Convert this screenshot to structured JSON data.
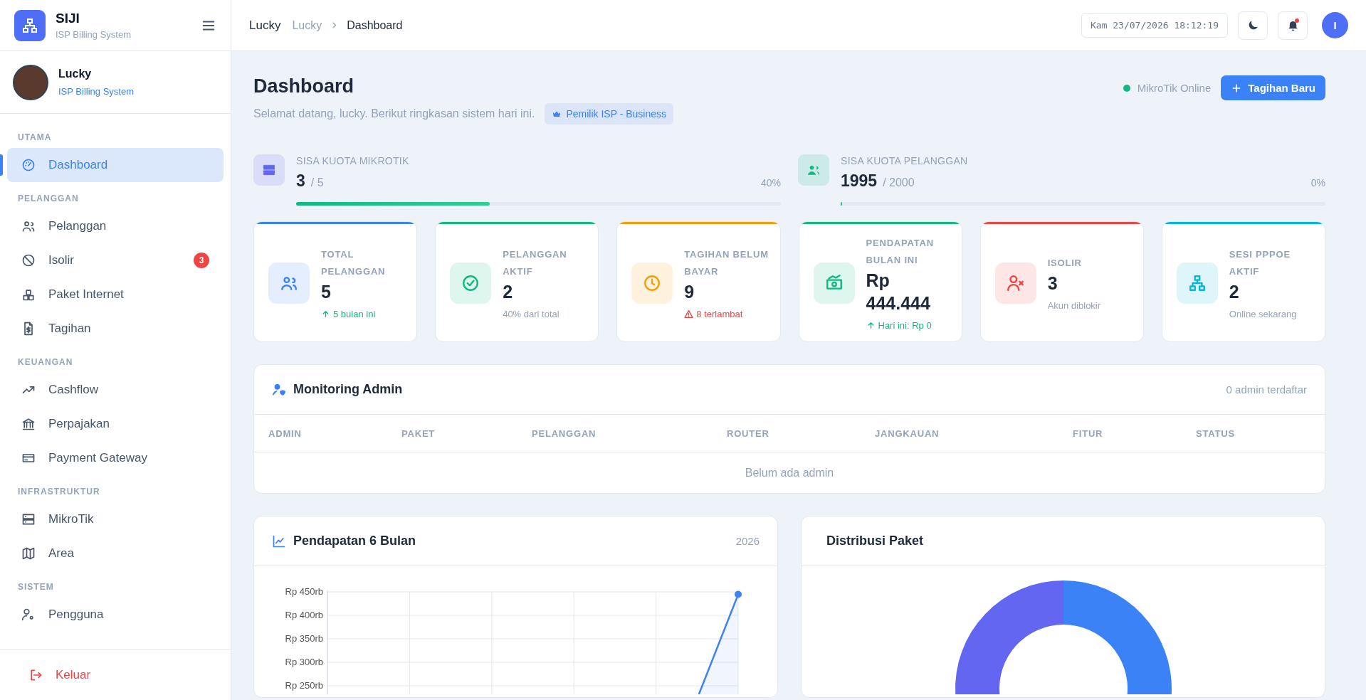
{
  "sidebar": {
    "brand": {
      "name": "SIJI",
      "subtitle": "ISP Billing System"
    },
    "user": {
      "name": "Lucky",
      "role": "ISP Billing System"
    },
    "sections": [
      {
        "title": "UTAMA",
        "items": [
          {
            "label": "Dashboard",
            "selected": true
          }
        ]
      },
      {
        "title": "PELANGGAN",
        "items": [
          {
            "label": "Pelanggan",
            "selected": false
          },
          {
            "label": "Isolir",
            "selected": false,
            "badge": "3"
          },
          {
            "label": "Paket Internet",
            "selected": false
          },
          {
            "label": "Tagihan",
            "selected": false
          }
        ]
      },
      {
        "title": "KEUANGAN",
        "items": [
          {
            "label": "Cashflow",
            "selected": false
          },
          {
            "label": "Perpajakan",
            "selected": false
          },
          {
            "label": "Payment Gateway",
            "selected": false
          }
        ]
      },
      {
        "title": "INFRASTRUKTUR",
        "items": [
          {
            "label": "MikroTik",
            "selected": false
          },
          {
            "label": "Area",
            "selected": false
          }
        ]
      },
      {
        "title": "SISTEM",
        "items": [
          {
            "label": "Pengguna",
            "selected": false
          }
        ]
      }
    ],
    "logout": "Keluar"
  },
  "header": {
    "title": "Lucky",
    "breadcrumb": [
      "Lucky",
      "Dashboard"
    ],
    "clock": "Kam 23/07/2026 18:12:19",
    "notification_unread": true,
    "avatar": "I"
  },
  "page": {
    "title": "Dashboard",
    "subtitle": "Selamat datang, lucky. Berikut ringkasan sistem hari ini.",
    "badge": "Pemilik ISP - Business",
    "router_status": {
      "label": "MikroTik Online",
      "online": true
    },
    "primary_button": "Tagihan Baru"
  },
  "quotas": [
    {
      "label": "SISA KUOTA MIKROTIK",
      "value": "3",
      "total": "/ 5",
      "percent": "40%",
      "level": 0.4,
      "color": "#6366f1"
    },
    {
      "label": "SISA KUOTA PELANGGAN",
      "value": "1995",
      "total": "/ 2000",
      "percent": "0%",
      "level": 0.0025,
      "color": "#10b981"
    }
  ],
  "stats": [
    {
      "label": "TOTAL PELANGGAN",
      "value": "5",
      "note": {
        "text": "5 bulan ini",
        "kind": "up"
      },
      "color": "#3b82f6"
    },
    {
      "label": "PELANGGAN AKTIF",
      "value": "2",
      "note": {
        "text": "40% dari total",
        "kind": "plain"
      },
      "color": "#10b981"
    },
    {
      "label": "TAGIHAN BELUM BAYAR",
      "value": "9",
      "note": {
        "text": "8 terlambat",
        "kind": "warn"
      },
      "color": "#f59e0b"
    },
    {
      "label": "PENDAPATAN BULAN INI",
      "value": "Rp 444.444",
      "note": {
        "text": "Hari ini: Rp 0",
        "kind": "up"
      },
      "color": "#10b981"
    },
    {
      "label": "ISOLIR",
      "value": "3",
      "note": {
        "text": "Akun diblokir",
        "kind": "plain"
      },
      "color": "#ef4444"
    },
    {
      "label": "SESI PPPOE AKTIF",
      "value": "2",
      "note": {
        "text": "Online sekarang",
        "kind": "plain"
      },
      "color": "#06b6d4"
    }
  ],
  "monitoring": {
    "title": "Monitoring Admin",
    "count": "0 admin terdaftar",
    "columns": [
      "ADMIN",
      "PAKET",
      "PELANGGAN",
      "ROUTER",
      "JANGKAUAN",
      "FITUR",
      "STATUS"
    ],
    "empty": "Belum ada admin"
  },
  "revenue": {
    "title": "Pendapatan 6 Bulan",
    "year": "2026",
    "y_axis_labels": [
      "Rp 450rb",
      "Rp 400rb",
      "Rp 350rb",
      "Rp 300rb",
      "Rp 250rb"
    ]
  },
  "distribution": {
    "title": "Distribusi Paket"
  }
}
